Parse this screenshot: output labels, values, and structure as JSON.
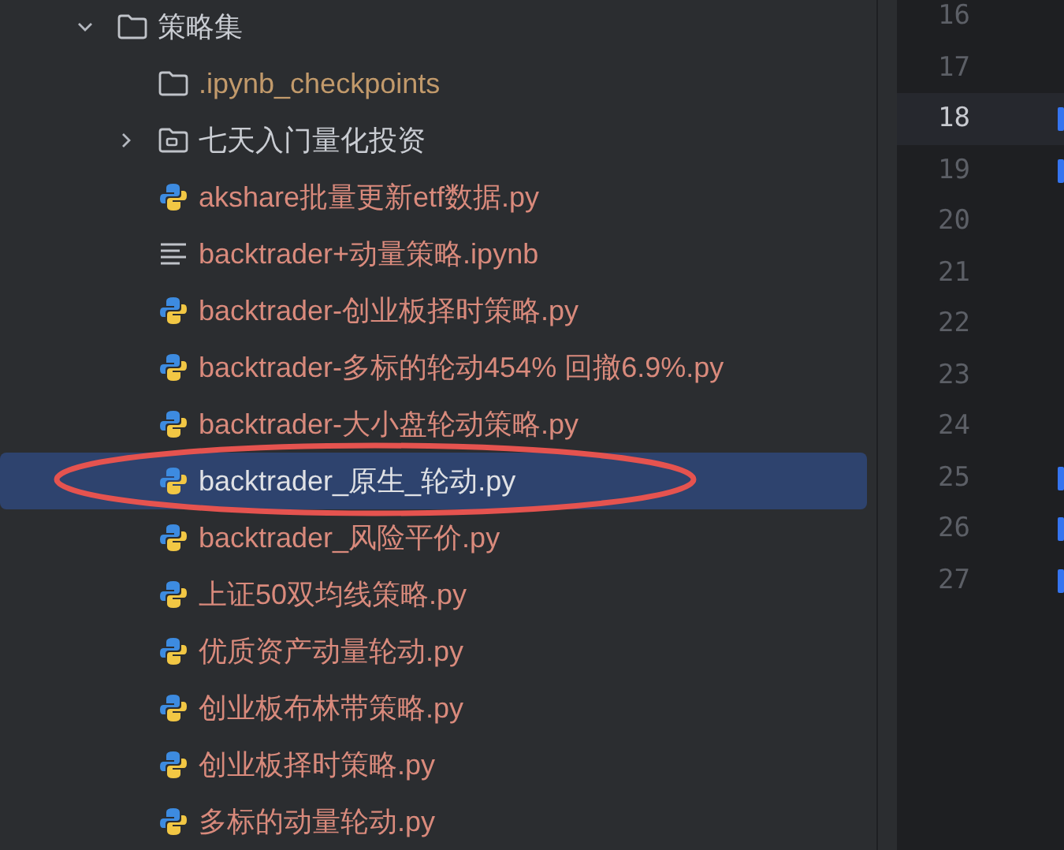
{
  "tree": [
    {
      "kind": "folder",
      "name": "策略集",
      "expanded": true,
      "selected": false,
      "color": "#c9ccd2",
      "children": [
        {
          "kind": "folder",
          "name": ".ipynb_checkpoints",
          "selected": false,
          "color": "#c29a6b"
        },
        {
          "kind": "package",
          "name": "七天入门量化投资",
          "expanded": false,
          "selected": false,
          "color": "#c9ccd2"
        },
        {
          "kind": "python",
          "name": "akshare批量更新etf数据.py",
          "selected": false,
          "color": "#d98a7c"
        },
        {
          "kind": "notebook",
          "name": "backtrader+动量策略.ipynb",
          "selected": false,
          "color": "#d98a7c"
        },
        {
          "kind": "python",
          "name": "backtrader-创业板择时策略.py",
          "selected": false,
          "color": "#d98a7c"
        },
        {
          "kind": "python",
          "name": "backtrader-多标的轮动454% 回撤6.9%.py",
          "selected": false,
          "color": "#d98a7c"
        },
        {
          "kind": "python",
          "name": "backtrader-大小盘轮动策略.py",
          "selected": false,
          "color": "#d98a7c"
        },
        {
          "kind": "python",
          "name": "backtrader_原生_轮动.py",
          "selected": true,
          "color": "#dfe1e5"
        },
        {
          "kind": "python",
          "name": "backtrader_风险平价.py",
          "selected": false,
          "color": "#d98a7c"
        },
        {
          "kind": "python",
          "name": "上证50双均线策略.py",
          "selected": false,
          "color": "#d98a7c"
        },
        {
          "kind": "python",
          "name": "优质资产动量轮动.py",
          "selected": false,
          "color": "#d98a7c"
        },
        {
          "kind": "python",
          "name": "创业板布林带策略.py",
          "selected": false,
          "color": "#d98a7c"
        },
        {
          "kind": "python",
          "name": "创业板择时策略.py",
          "selected": false,
          "color": "#d98a7c"
        },
        {
          "kind": "python",
          "name": "多标的动量轮动.py",
          "selected": false,
          "color": "#d98a7c"
        }
      ]
    }
  ],
  "gutter": [
    {
      "number": "16",
      "current": false,
      "changed": false
    },
    {
      "number": "17",
      "current": false,
      "changed": false
    },
    {
      "number": "18",
      "current": true,
      "changed": true
    },
    {
      "number": "19",
      "current": false,
      "changed": true
    },
    {
      "number": "20",
      "current": false,
      "changed": false
    },
    {
      "number": "21",
      "current": false,
      "changed": false
    },
    {
      "number": "22",
      "current": false,
      "changed": false
    },
    {
      "number": "23",
      "current": false,
      "changed": false
    },
    {
      "number": "24",
      "current": false,
      "changed": false
    },
    {
      "number": "25",
      "current": false,
      "changed": true
    },
    {
      "number": "26",
      "current": false,
      "changed": true
    },
    {
      "number": "27",
      "current": false,
      "changed": true
    }
  ]
}
